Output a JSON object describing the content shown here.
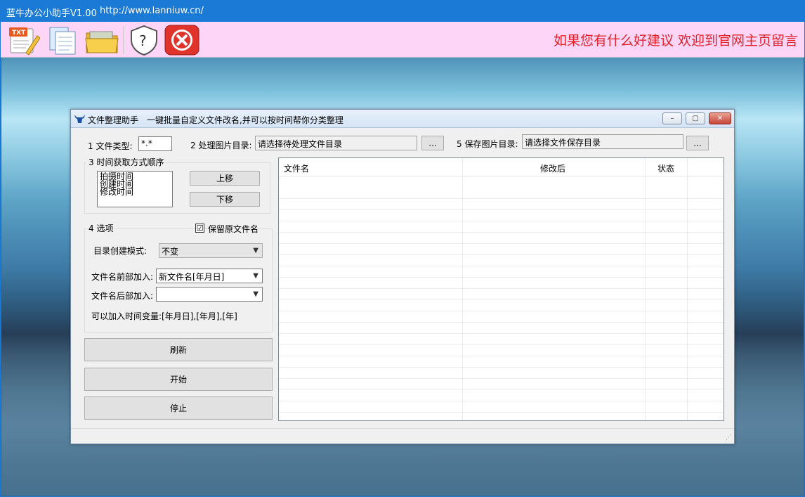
{
  "app": {
    "title": "蓝牛办公小助手V1.00",
    "url": "http://www.lanniuw.cn/"
  },
  "toolbar": {
    "slogan": "如果您有什么好建议 欢迎到官网主页留言",
    "icons": [
      "txt-edit-icon",
      "copy-docs-icon",
      "folder-icon",
      "help-shield-icon",
      "close-circle-icon"
    ],
    "tool_btn_icon_text": "TXT",
    "help_glyph": "?",
    "exit_glyph": "✕"
  },
  "dialog": {
    "title": "文件整理助手",
    "subtitle": "一键批量自定义文件改名,并可以按时间帮你分类整理",
    "controls": {
      "minimize": "–",
      "maximize": "▢",
      "close": "✕"
    }
  },
  "form": {
    "file_type_label": "1 文件类型:",
    "file_type_value": "*.*",
    "source_dir_label": "2 处理图片目录:",
    "source_dir_value": "请选择待处理文件目录",
    "browse_label": "...",
    "save_dir_label": "5 保存图片目录:",
    "save_dir_value": "请选择文件保存目录",
    "time_group_title": "3 时间获取方式顺序",
    "time_order": [
      "拍摄时间",
      "创建时间",
      "修改时间"
    ],
    "move_up": "上移",
    "move_down": "下移",
    "options_group_title": "4 选项",
    "keep_name_label": "保留原文件名",
    "keep_name_checked": "☑",
    "dir_mode_label": "目录创建模式:",
    "dir_mode_value": "不变",
    "prefix_label": "文件名前部加入:",
    "prefix_value": "新文件名[年月日]",
    "suffix_label": "文件名后部加入:",
    "suffix_value": "",
    "time_var_hint": "可以加入时间变量:[年月日],[年月],[年]",
    "refresh": "刷新",
    "start": "开始",
    "stop": "停止"
  },
  "table": {
    "columns": [
      "文件名",
      "修改后",
      "状态"
    ],
    "rows": []
  },
  "status": {
    "grip": "⋰"
  }
}
